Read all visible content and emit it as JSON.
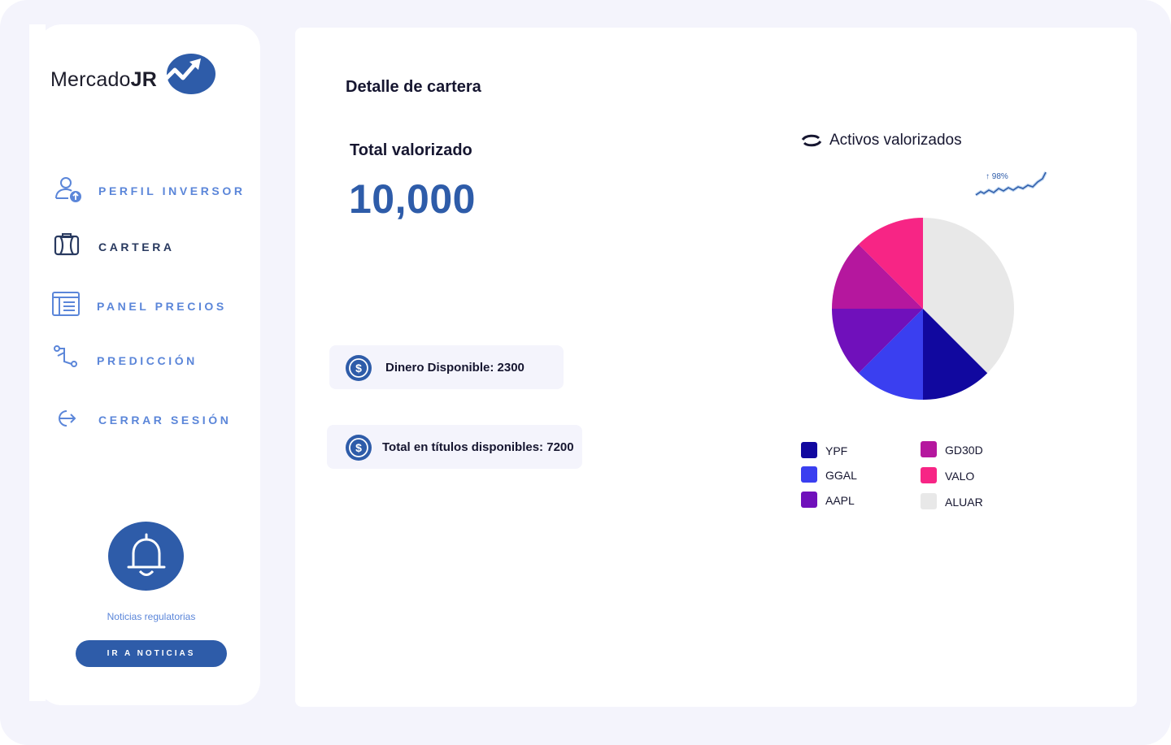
{
  "brand": {
    "name_regular": "Mercado",
    "name_bold": "JR"
  },
  "sidebar": {
    "items": [
      {
        "label": "PERFIL INVERSOR",
        "icon": "user-upload-icon",
        "active": false
      },
      {
        "label": "CARTERA",
        "icon": "briefcase-icon",
        "active": true
      },
      {
        "label": "PANEL PRECIOS",
        "icon": "list-panel-icon",
        "active": false
      },
      {
        "label": "PREDICCIÓN",
        "icon": "path-icon",
        "active": false
      },
      {
        "label": "CERRAR SESIÓN",
        "icon": "logout-icon",
        "active": false
      }
    ],
    "news_label": "Noticias regulatorias",
    "news_button": "IR A NOTICIAS"
  },
  "main": {
    "title": "Detalle de cartera",
    "total_label": "Total valorizado",
    "total_value": "10,000",
    "cash": "Dinero Disponible: 2300",
    "titles": "Total en títulos disponibles:  7200"
  },
  "chart_header": {
    "title": "Activos valorizados",
    "trend": "↑ 98%"
  },
  "colors": {
    "primary": "#2e5ca9",
    "accent_blue": "#5b86d9",
    "background": "#f4f4fc"
  },
  "chart_data": {
    "type": "pie",
    "title": "Activos valorizados",
    "series": [
      {
        "name": "YPF",
        "value": 12.5,
        "color": "#11089f"
      },
      {
        "name": "GGAL",
        "value": 12.5,
        "color": "#3a3ff0"
      },
      {
        "name": "AAPL",
        "value": 12.5,
        "color": "#7010bb"
      },
      {
        "name": "GD30D",
        "value": 12.5,
        "color": "#b5179e"
      },
      {
        "name": "VALO",
        "value": 12.5,
        "color": "#f72585"
      },
      {
        "name": "ALUAR",
        "value": 37.5,
        "color": "#e8e8e8"
      }
    ],
    "legend_position": "bottom"
  }
}
